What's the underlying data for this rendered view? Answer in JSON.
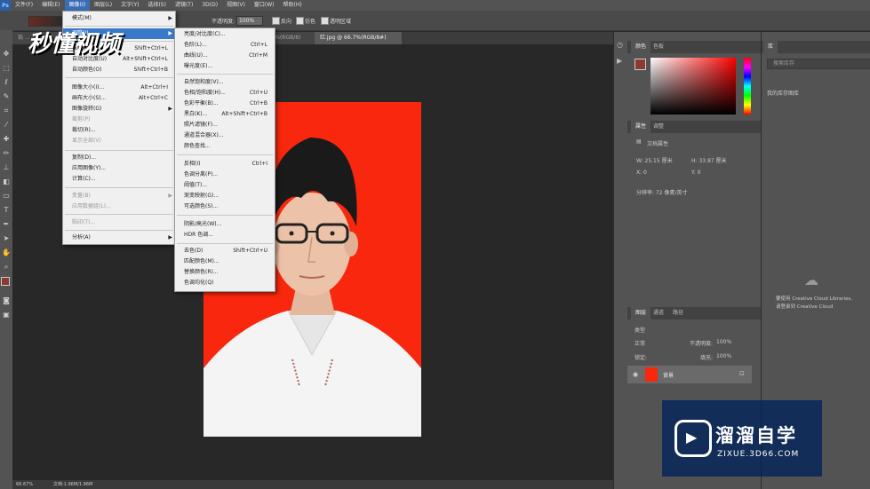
{
  "menubar": {
    "app_icon": "Ps",
    "items": [
      "文件(F)",
      "编辑(E)",
      "图像(I)",
      "图层(L)",
      "文字(Y)",
      "选择(S)",
      "滤镜(T)",
      "3D(D)",
      "视图(V)",
      "窗口(W)",
      "帮助(H)"
    ],
    "active_index": 2
  },
  "options": {
    "opacity_label": "不透明度:",
    "opacity_value": "100%",
    "reverse": "反向",
    "dither": "仿色",
    "transparency": "透明区域"
  },
  "tabs": {
    "inactive": "铅 ...",
    "inactive2": "@ 66.7%(RGB/8)",
    "active": "红.jpg @ 66.7%(RGB/8#)"
  },
  "status": {
    "zoom": "66.67%",
    "doc": "文档:1.96M/1.96M"
  },
  "image_menu": [
    {
      "label": "模式(M)",
      "arrow": true
    },
    {
      "sep": true
    },
    {
      "label": "调整(J)",
      "arrow": true,
      "highlight": true
    },
    {
      "sep": true
    },
    {
      "label": "自动色调(N)",
      "shortcut": "Shift+Ctrl+L"
    },
    {
      "label": "自动对比度(U)",
      "shortcut": "Alt+Shift+Ctrl+L"
    },
    {
      "label": "自动颜色(O)",
      "shortcut": "Shift+Ctrl+B"
    },
    {
      "sep": true
    },
    {
      "label": "图像大小(I)...",
      "shortcut": "Alt+Ctrl+I"
    },
    {
      "label": "画布大小(S)...",
      "shortcut": "Alt+Ctrl+C"
    },
    {
      "label": "图像旋转(G)",
      "arrow": true
    },
    {
      "label": "裁剪(P)",
      "disabled": true
    },
    {
      "label": "裁切(R)..."
    },
    {
      "label": "显示全部(V)",
      "disabled": true
    },
    {
      "sep": true
    },
    {
      "label": "复制(D)..."
    },
    {
      "label": "应用图像(Y)..."
    },
    {
      "label": "计算(C)..."
    },
    {
      "sep": true
    },
    {
      "label": "变量(B)",
      "arrow": true,
      "disabled": true
    },
    {
      "label": "应用数据组(L)...",
      "disabled": true
    },
    {
      "sep": true
    },
    {
      "label": "陷印(T)...",
      "disabled": true
    },
    {
      "sep": true
    },
    {
      "label": "分析(A)",
      "arrow": true
    }
  ],
  "adjust_menu": [
    {
      "label": "亮度/对比度(C)..."
    },
    {
      "label": "色阶(L)...",
      "shortcut": "Ctrl+L"
    },
    {
      "label": "曲线(U)...",
      "shortcut": "Ctrl+M"
    },
    {
      "label": "曝光度(E)..."
    },
    {
      "sep": true
    },
    {
      "label": "自然饱和度(V)..."
    },
    {
      "label": "色相/饱和度(H)...",
      "shortcut": "Ctrl+U"
    },
    {
      "label": "色彩平衡(B)...",
      "shortcut": "Ctrl+B"
    },
    {
      "label": "黑白(K)...",
      "shortcut": "Alt+Shift+Ctrl+B"
    },
    {
      "label": "照片滤镜(F)..."
    },
    {
      "label": "通道混合器(X)..."
    },
    {
      "label": "颜色查找..."
    },
    {
      "sep": true
    },
    {
      "label": "反相(I)",
      "shortcut": "Ctrl+I"
    },
    {
      "label": "色调分离(P)..."
    },
    {
      "label": "阈值(T)..."
    },
    {
      "label": "渐变映射(G)..."
    },
    {
      "label": "可选颜色(S)..."
    },
    {
      "sep": true
    },
    {
      "label": "阴影/高光(W)..."
    },
    {
      "label": "HDR 色调..."
    },
    {
      "sep": true
    },
    {
      "label": "去色(D)",
      "shortcut": "Shift+Ctrl+U"
    },
    {
      "label": "匹配颜色(M)..."
    },
    {
      "label": "替换颜色(R)..."
    },
    {
      "label": "色调均化(Q)"
    }
  ],
  "color_panel": {
    "tabs": [
      "颜色",
      "色板"
    ]
  },
  "properties_panel": {
    "tabs": [
      "属性",
      "调整"
    ],
    "title": "文档属性",
    "w": "W:  25.15 厘米",
    "h": "H:  33.87 厘米",
    "x": "X:  0",
    "y": "Y:  0",
    "res": "分辨率: 72 像素/英寸"
  },
  "layers_panel": {
    "tabs": [
      "图层",
      "通道",
      "路径"
    ],
    "kind": "类型",
    "mode": "正常",
    "opacity_label": "不透明度:",
    "opacity_value": "100%",
    "lock_label": "锁定:",
    "fill_label": "填充:",
    "fill_value": "100%",
    "layer_name": "背景"
  },
  "library_panel": {
    "tab": "库",
    "search": "搜索库存",
    "lib_name": "我的库存图库",
    "msg1": "要使用 Creative Cloud Libraries,",
    "msg2": "请登录到 Creative Cloud"
  },
  "watermark": {
    "top": "秒懂视频",
    "brand_cn": "溜溜自学",
    "brand_url": "ZIXUE.3D66.COM"
  },
  "colors": {
    "photo_bg": "#f8270e",
    "menu_highlight": "#3a78c9",
    "fg_swatch": "#8a3a30"
  }
}
